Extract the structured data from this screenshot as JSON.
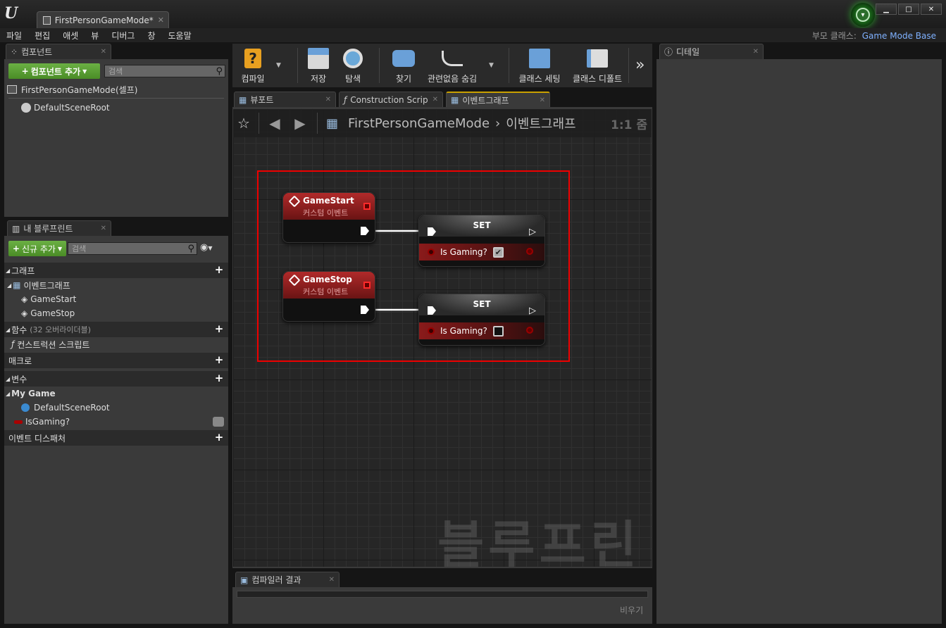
{
  "window": {
    "doc_tab": "FirstPersonGameMode*"
  },
  "menu": [
    "파일",
    "편집",
    "애셋",
    "뷰",
    "디버그",
    "창",
    "도움말"
  ],
  "parent_class": {
    "label": "부모 클래스:",
    "value": "Game Mode Base"
  },
  "components": {
    "tab": "컴포넌트",
    "add_button": "컴포넌트 추가",
    "search_placeholder": "검색",
    "self_item": "FirstPersonGameMode(셀프)",
    "root_item": "DefaultSceneRoot"
  },
  "my_blueprint": {
    "tab": "내 블루프린트",
    "add_button": "신규 추가",
    "search_placeholder": "검색",
    "graphs": {
      "label": "그래프",
      "eventgraph": "이벤트그래프",
      "events": [
        "GameStart",
        "GameStop"
      ]
    },
    "functions": {
      "label": "함수",
      "count": "(32 오버라이더블)",
      "construction": "컨스트럭션 스크립트"
    },
    "macros": "매크로",
    "variables": {
      "label": "변수",
      "category": "My Game",
      "items": [
        "DefaultSceneRoot",
        "IsGaming?"
      ]
    },
    "dispatchers": "이벤트 디스패처"
  },
  "toolbar": {
    "compile": "컴파일",
    "save": "저장",
    "browse": "탐색",
    "find": "찾기",
    "hide_unrelated": "관련없음 숨김",
    "class_settings": "클래스 세팅",
    "class_defaults": "클래스 디폴트"
  },
  "editor_tabs": [
    "뷰포트",
    "Construction Scrip",
    "이벤트그래프"
  ],
  "graph": {
    "breadcrumb_root": "FirstPersonGameMode",
    "breadcrumb_leaf": "이벤트그래프",
    "zoom": "1:1 줌",
    "watermark": "블루프린트",
    "nodes": [
      {
        "event_title": "GameStart",
        "event_sub": "커스텀 이벤트",
        "set_title": "SET",
        "var": "Is Gaming?",
        "checked": true
      },
      {
        "event_title": "GameStop",
        "event_sub": "커스텀 이벤트",
        "set_title": "SET",
        "var": "Is Gaming?",
        "checked": false
      }
    ]
  },
  "compiler": {
    "tab": "컴파일러 결과",
    "clear": "비우기"
  },
  "details": {
    "tab": "디테일"
  },
  "colors": {
    "accent_green": "#4a8c26",
    "highlight_red": "#ee0000",
    "event_red": "#b02a2a"
  }
}
